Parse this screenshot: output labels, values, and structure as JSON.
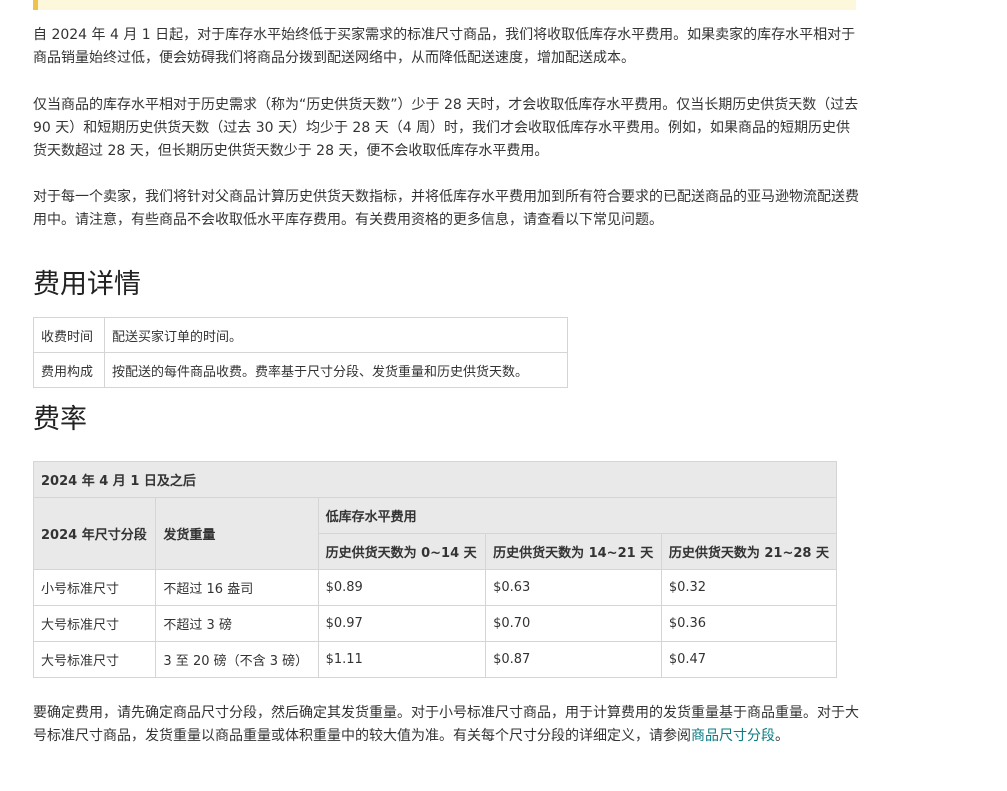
{
  "intro": {
    "p1": "自 2024 年 4 月 1 日起，对于库存水平始终低于买家需求的标准尺寸商品，我们将收取低库存水平费用。如果卖家的库存水平相对于商品销量始终过低，便会妨碍我们将商品分拨到配送网络中，从而降低配送速度，增加配送成本。",
    "p2": "仅当商品的库存水平相对于历史需求（称为“历史供货天数”）少于 28 天时，才会收取低库存水平费用。仅当长期历史供货天数（过去 90 天）和短期历史供货天数（过去 30 天）均少于 28 天（4 周）时，我们才会收取低库存水平费用。例如，如果商品的短期历史供货天数超过 28 天，但长期历史供货天数少于 28 天，便不会收取低库存水平费用。",
    "p3": "对于每一个卖家，我们将针对父商品计算历史供货天数指标，并将低库存水平费用加到所有符合要求的已配送商品的亚马逊物流配送费用中。请注意，有些商品不会收取低水平库存费用。有关费用资格的更多信息，请查看以下常见问题。"
  },
  "fee_details": {
    "heading": "费用详情",
    "rows": [
      {
        "key": "收费时间",
        "value": "配送买家订单的时间。"
      },
      {
        "key": "费用构成",
        "value": "按配送的每件商品收费。费率基于尺寸分段、发货重量和历史供货天数。"
      }
    ]
  },
  "rates": {
    "heading": "费率",
    "table_title": "2024 年 4 月 1 日及之后",
    "col_size_tier": "2024 年尺寸分段",
    "col_weight": "发货重量",
    "col_fee_group": "低库存水平费用",
    "fee_cols": [
      "历史供货天数为 0~14 天",
      "历史供货天数为 14~21 天",
      "历史供货天数为 21~28 天"
    ],
    "rows": [
      {
        "tier": "小号标准尺寸",
        "weight": "不超过 16 盎司",
        "fees": [
          "$0.89",
          "$0.63",
          "$0.32"
        ]
      },
      {
        "tier": "大号标准尺寸",
        "weight": "不超过 3 磅",
        "fees": [
          "$0.97",
          "$0.70",
          "$0.36"
        ]
      },
      {
        "tier": "大号标准尺寸",
        "weight": "3 至 20 磅（不含 3 磅）",
        "fees": [
          "$1.11",
          "$0.87",
          "$0.47"
        ]
      }
    ]
  },
  "footer": {
    "text": "要确定费用，请先确定商品尺寸分段，然后确定其发货重量。对于小号标准尺寸商品，用于计算费用的发货重量基于商品重量。对于大号标准尺寸商品，发货重量以商品重量或体积重量中的较大值为准。有关每个尺寸分段的详细定义，请参阅",
    "link_text": "商品尺寸分段",
    "tail": "。"
  },
  "colors": {
    "link": "#0a7b83",
    "table_header_bg": "#e9e9e9",
    "notice_border": "#f0c24a"
  }
}
